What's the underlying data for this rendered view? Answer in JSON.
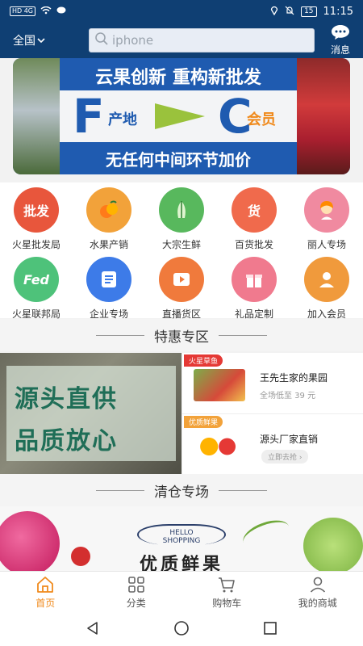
{
  "status": {
    "signal": "HD 4G",
    "battery": "15",
    "time": "11:15"
  },
  "header": {
    "region": "全国",
    "search_placeholder": "iphone",
    "message_label": "消息"
  },
  "banner": {
    "title": "云果创新 重构新批发",
    "left_letter": "F",
    "left_label": "产地",
    "right_letter": "C",
    "right_label": "会员",
    "subtitle": "无任何中间环节加价"
  },
  "categories": [
    {
      "label": "火星批发局",
      "icon_name": "wholesale-icon",
      "icon_text": "批发",
      "color": "#e8563c"
    },
    {
      "label": "水果产销",
      "icon_name": "fruit-icon",
      "icon_text": "",
      "color": "#f2a23a"
    },
    {
      "label": "大宗生鲜",
      "icon_name": "vegetable-icon",
      "icon_text": "",
      "color": "#58b85d"
    },
    {
      "label": "百货批发",
      "icon_name": "goods-icon",
      "icon_text": "货",
      "color": "#f06a4c"
    },
    {
      "label": "丽人专场",
      "icon_name": "beauty-icon",
      "icon_text": "",
      "color": "#f08aa0"
    },
    {
      "label": "火星联邦局",
      "icon_name": "fed-icon",
      "icon_text": "Fed",
      "color": "#4ec27a"
    },
    {
      "label": "企业专场",
      "icon_name": "enterprise-icon",
      "icon_text": "",
      "color": "#3d7be8"
    },
    {
      "label": "直播货区",
      "icon_name": "live-icon",
      "icon_text": "",
      "color": "#f07a3c"
    },
    {
      "label": "礼品定制",
      "icon_name": "gift-icon",
      "icon_text": "",
      "color": "#f07a8e"
    },
    {
      "label": "加入会员",
      "icon_name": "member-icon",
      "icon_text": "",
      "color": "#f09a3c"
    }
  ],
  "sections": {
    "special": "特惠专区",
    "clearance": "清仓专场"
  },
  "promo": {
    "image_line1": "源头直供",
    "image_line2": "品质放心",
    "items": [
      {
        "tag": "火星草鱼",
        "title": "王先生家的果园",
        "subtitle": "全场低至 39 元",
        "tag_color": "#e53935"
      },
      {
        "tag": "优质鲜果",
        "title": "源头厂家直销",
        "button": "立即去抢 ›",
        "tag_color": "#f2a23a"
      }
    ]
  },
  "clearance_banner": {
    "logo_line1": "HELLO",
    "logo_line2": "SHOPPING",
    "text": "优质鲜果"
  },
  "tabs": [
    {
      "label": "首页",
      "icon": "home-icon",
      "active": true
    },
    {
      "label": "分类",
      "icon": "grid-icon",
      "active": false
    },
    {
      "label": "购物车",
      "icon": "cart-icon",
      "active": false
    },
    {
      "label": "我的商城",
      "icon": "user-icon",
      "active": false
    }
  ],
  "colors": {
    "header_bg": "#0f3f73",
    "accent": "#f08a1c"
  }
}
